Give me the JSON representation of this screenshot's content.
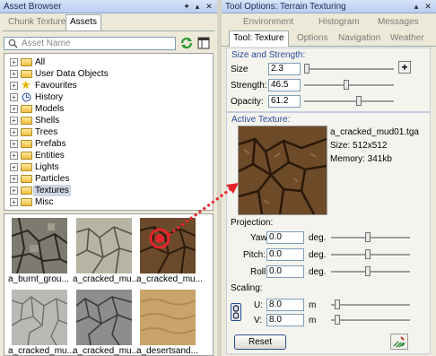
{
  "asset_browser": {
    "title": "Asset Browser",
    "tabs": [
      "Chunk Textures",
      "Assets"
    ],
    "search_placeholder": "Asset Name",
    "tree": [
      {
        "label": "All",
        "icon": "folder-icon"
      },
      {
        "label": "User Data Objects",
        "icon": "folder-icon"
      },
      {
        "label": "Favourites",
        "icon": "star-icon"
      },
      {
        "label": "History",
        "icon": "history-icon"
      },
      {
        "label": "Models",
        "icon": "folder-icon"
      },
      {
        "label": "Shells",
        "icon": "folder-icon"
      },
      {
        "label": "Trees",
        "icon": "folder-icon"
      },
      {
        "label": "Prefabs",
        "icon": "folder-icon"
      },
      {
        "label": "Entities",
        "icon": "folder-icon"
      },
      {
        "label": "Lights",
        "icon": "folder-icon"
      },
      {
        "label": "Particles",
        "icon": "folder-icon"
      },
      {
        "label": "Textures",
        "icon": "folder-icon",
        "selected": true
      },
      {
        "label": "Misc",
        "icon": "folder-icon"
      }
    ],
    "thumbnails": [
      {
        "label": "a_burnt_grou..."
      },
      {
        "label": "a_cracked_mu..."
      },
      {
        "label": "a_cracked_mu..."
      },
      {
        "label": "a_cracked_mu..."
      },
      {
        "label": "a_cracked_mu..."
      },
      {
        "label": "a_desertsand..."
      }
    ]
  },
  "tool_options": {
    "title": "Tool Options: Terrain Texturing",
    "tabs_row1": [
      "Environment",
      "Histogram",
      "Messages"
    ],
    "tabs_row2": [
      "Tool: Texture",
      "Options",
      "Navigation",
      "Weather"
    ],
    "size_strength": {
      "title": "Size and Strength:",
      "size_label": "Size",
      "size_value": "2.3",
      "strength_label": "Strength:",
      "strength_value": "46.5",
      "opacity_label": "Opacity:",
      "opacity_value": "61.2"
    },
    "active_texture": {
      "title": "Active Texture:",
      "name": "a_cracked_mud01.tga",
      "size": "Size:  512x512",
      "memory": "Memory: 341kb"
    },
    "projection": {
      "title": "Projection:",
      "yaw_label": "Yaw:",
      "yaw_value": "0.0",
      "yaw_unit": "deg.",
      "pitch_label": "Pitch:",
      "pitch_value": "0.0",
      "pitch_unit": "deg.",
      "roll_label": "Roll:",
      "roll_value": "0.0",
      "roll_unit": "deg."
    },
    "scaling": {
      "title": "Scaling:",
      "u_label": "U:",
      "u_value": "8.0",
      "u_unit": "m",
      "v_label": "V:",
      "v_value": "8.0",
      "v_unit": "m"
    },
    "reset_label": "Reset"
  },
  "colors": {
    "panel_bg": "#ece9d8",
    "section_title": "#2a4b9b",
    "arrow": "#e8242b"
  }
}
